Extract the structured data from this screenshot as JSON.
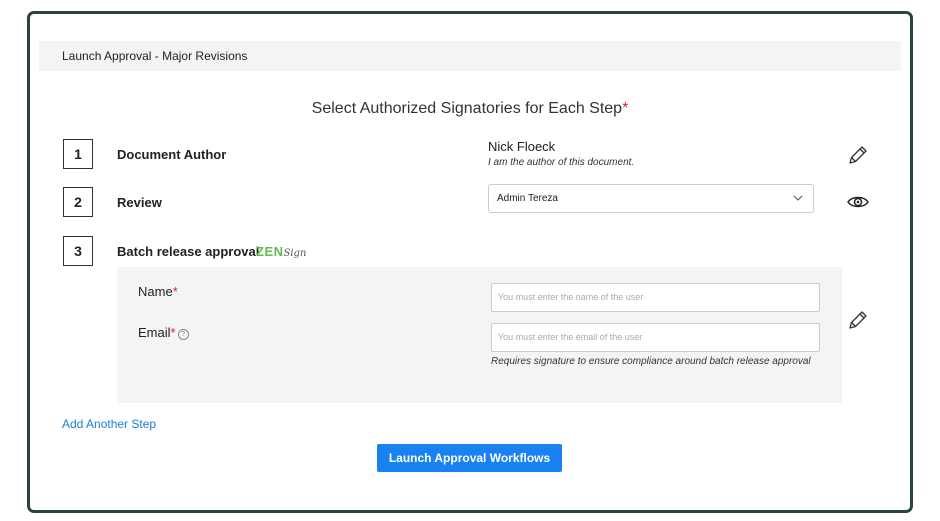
{
  "breadcrumb": "Launch Approval - Major Revisions",
  "heading": "Select Authorized Signatories for Each Step",
  "required_mark": "*",
  "steps": [
    {
      "number": "1",
      "label": "Document Author",
      "author_name": "Nick Floeck",
      "author_note": "I am the author of this document.",
      "action_icon": "pencil-icon"
    },
    {
      "number": "2",
      "label": "Review",
      "selected_value": "Admin Tereza",
      "action_icon": "eye-icon"
    },
    {
      "number": "3",
      "label": "Batch release approval",
      "badge_main": "ZEN",
      "badge_sign": "Sign",
      "action_icon": "pencil-icon"
    }
  ],
  "form": {
    "name_label": "Name",
    "name_placeholder": "You must enter the name of the user",
    "email_label": "Email",
    "help_glyph": "?",
    "email_placeholder": "You must enter the email of the user",
    "hint": "Requires signature to ensure compliance around batch release approval"
  },
  "add_step_link": "Add Another Step",
  "launch_button": "Launch Approval Workflows",
  "colors": {
    "frame": "#26463f",
    "accent": "#1a82f0",
    "link": "#1a7fd8",
    "required": "#d9262b",
    "zen": "#5cbf4a"
  }
}
